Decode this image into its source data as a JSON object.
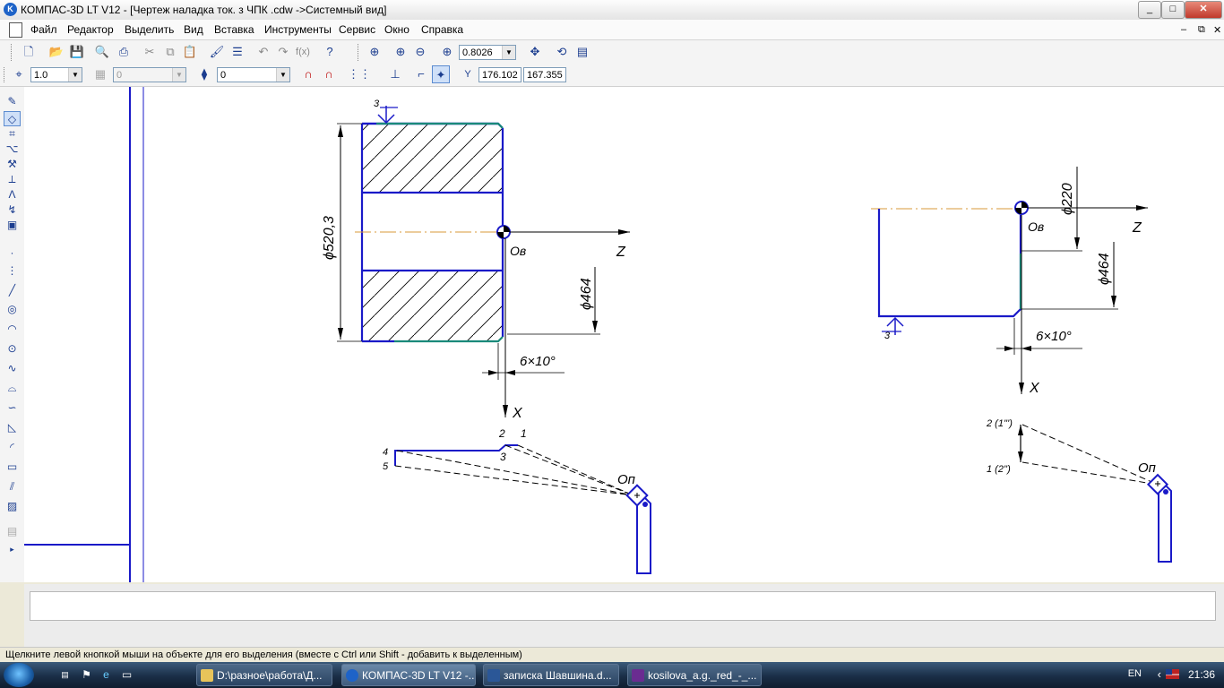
{
  "window": {
    "title": "КОМПАС-3D LT V12 - [Чертеж наладка ток. з ЧПК .cdw ->Системный вид]",
    "app_icon": "K",
    "buttons": {
      "minimize": "_",
      "maximize": "□",
      "close": "✕"
    }
  },
  "menu": {
    "items": [
      "Файл",
      "Редактор",
      "Выделить",
      "Вид",
      "Вставка",
      "Инструменты",
      "Сервис",
      "Окно",
      "Справка"
    ],
    "mdi_buttons": [
      "–",
      "⧉",
      "✕"
    ]
  },
  "toolbar_top": {
    "zoom_value": "0.8026",
    "icons": [
      "new-icon",
      "open-icon",
      "save-icon",
      "print-preview-icon",
      "print-icon",
      "cut-icon",
      "copy-icon",
      "paste-icon",
      "format-painter-icon",
      "properties-icon",
      "undo-icon",
      "redo-icon",
      "function-icon",
      "help-icon",
      "zoom-window-icon",
      "zoom-in-icon",
      "zoom-out-icon",
      "zoom-scale-icon",
      "pan-icon",
      "refresh-icon",
      "layers-icon"
    ]
  },
  "toolbar_current": {
    "step_value": "1.0",
    "layer_value": "0",
    "style_value": "0",
    "coord_x": "176.102",
    "coord_y": "167.355",
    "coord_label": "Y"
  },
  "drawing": {
    "left": {
      "section_label": "3",
      "diameter_label": "ϕ520,3",
      "origin_label": "Oв",
      "axis_z": "Z",
      "axis_x": "X",
      "dim_diameter": "ϕ464",
      "chamfer_label": "6×10°",
      "tool_point_labels": [
        "2",
        "1",
        "3",
        "4",
        "5"
      ],
      "tool_origin_label": "Oп"
    },
    "right": {
      "diameter_220": "ϕ220",
      "axis_z": "Z",
      "origin_label": "Oв",
      "dim_diameter": "ϕ464",
      "section_label": "3",
      "chamfer_label": "6×10°",
      "axis_x": "X",
      "point_2": "2 (1''')",
      "point_1": "1 (2'')",
      "tool_origin_label": "Oп"
    },
    "colors": {
      "contour": "#1a1ac8",
      "chamfer": "#1a8a7a",
      "centerline": "#d99a3a",
      "dimension": "#000000"
    }
  },
  "status": {
    "hint": "Щелкните левой кнопкой мыши на объекте для его выделения (вместе с Ctrl или Shift - добавить к выделенным)"
  },
  "taskbar": {
    "tasks": [
      {
        "label": "D:\\разное\\работа\\Д...",
        "icon_color": "#e8c45a"
      },
      {
        "label": "КОМПАС-3D LT V12 -...",
        "icon_color": "#1e63c8"
      },
      {
        "label": "записка Шавшина.d...",
        "icon_color": "#2b5797"
      },
      {
        "label": "kosilova_a.g._red_-_...",
        "icon_color": "#6a2c91"
      }
    ],
    "lang": "EN",
    "clock": "21:36"
  }
}
